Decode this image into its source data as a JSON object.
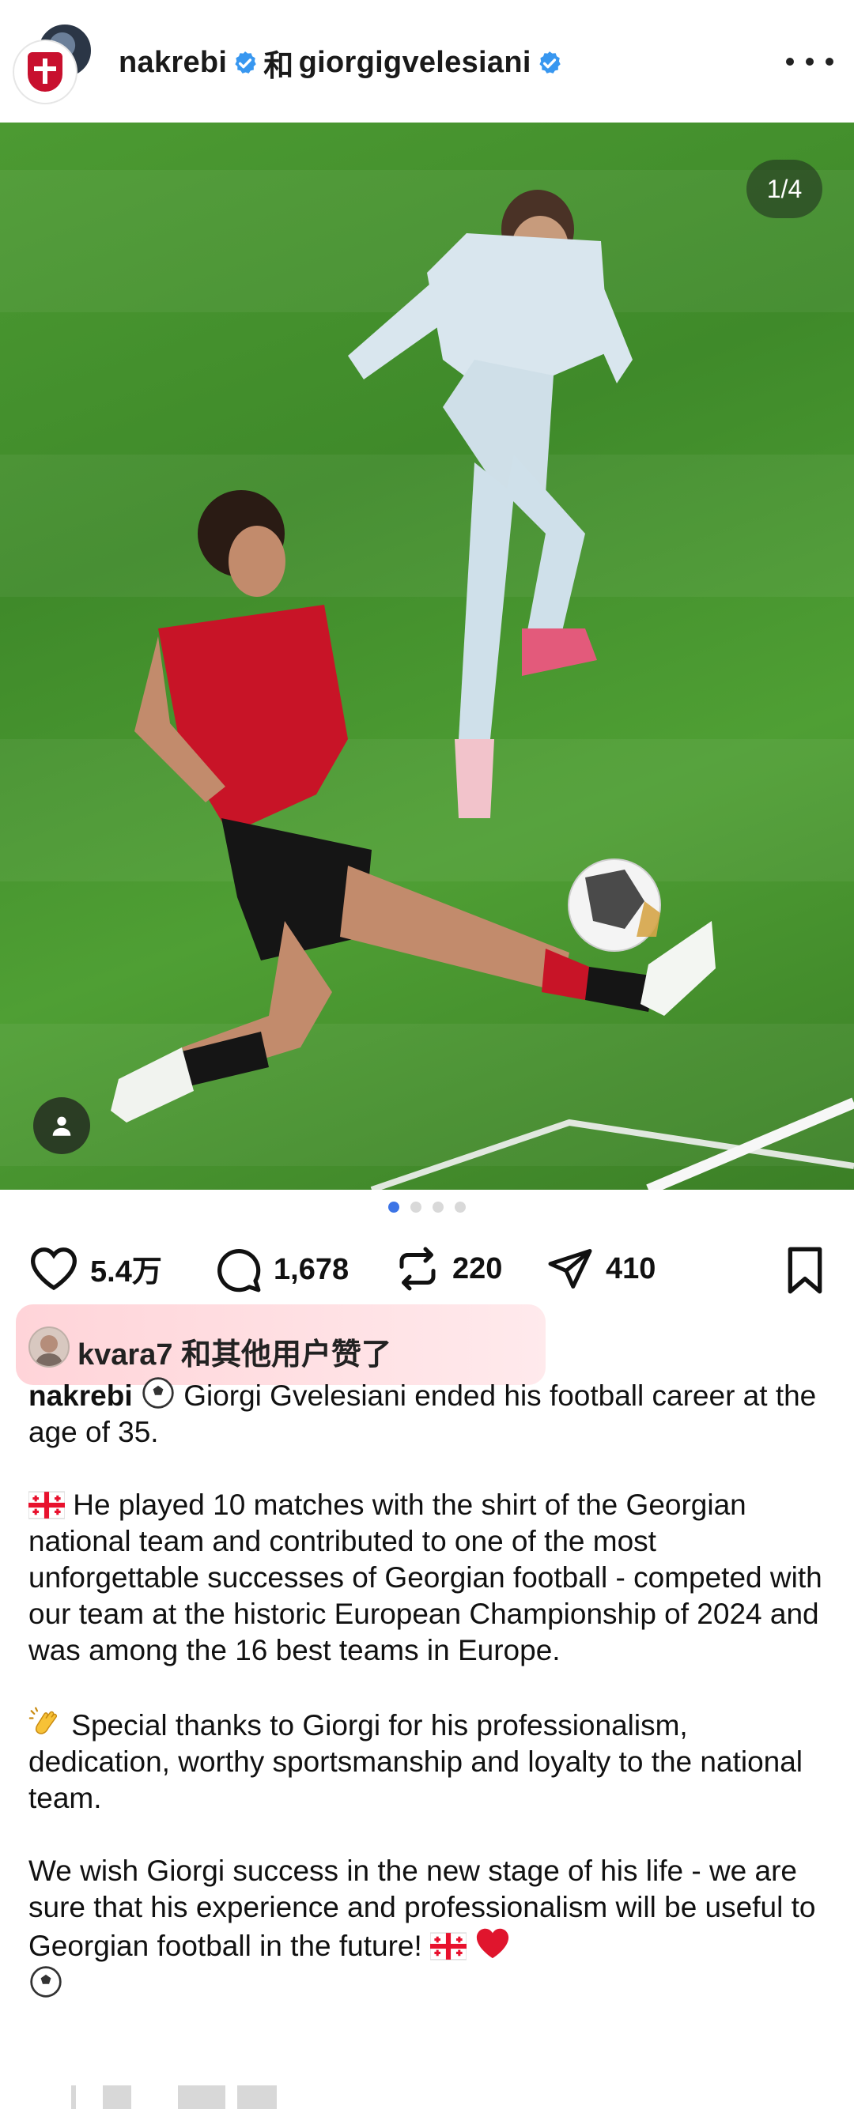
{
  "header": {
    "username_1": "nakrebi",
    "connector": "和",
    "username_2": "giorgigvelesiani",
    "more_icon": "more-horizontal-icon"
  },
  "post_image": {
    "page_indicator": "1/4",
    "description_icon": "person-tag-icon",
    "carousel": {
      "count": 4,
      "active": 1
    }
  },
  "actions": {
    "likes": "5.4万",
    "comments": "1,678",
    "reposts": "220",
    "shares": "410"
  },
  "liked_by": {
    "text": "kvara7 和其他用户赞了"
  },
  "caption": {
    "user": "nakrebi",
    "p1": "Giorgi Gvelesiani ended his football career at the age of 35.",
    "p2": "He played 10 matches with the shirt of the Georgian national team and contributed to one of the most unforgettable successes of Georgian football - competed with our team at the historic European Championship of 2024 and was among the 16 best teams in Europe.",
    "p3": "Special thanks to Giorgi for his professionalism, dedication, worthy sportsmanship and loyalty to the national team.",
    "p4": "We wish Giorgi success in the new stage of his life - we are sure that his experience and professionalism will be useful to Georgian football in the future!"
  },
  "colors": {
    "verified": "#3897f0",
    "carousel_active": "#3c74e6",
    "liked_highlight": "#ffb3bb",
    "heart_red": "#e0152d"
  }
}
